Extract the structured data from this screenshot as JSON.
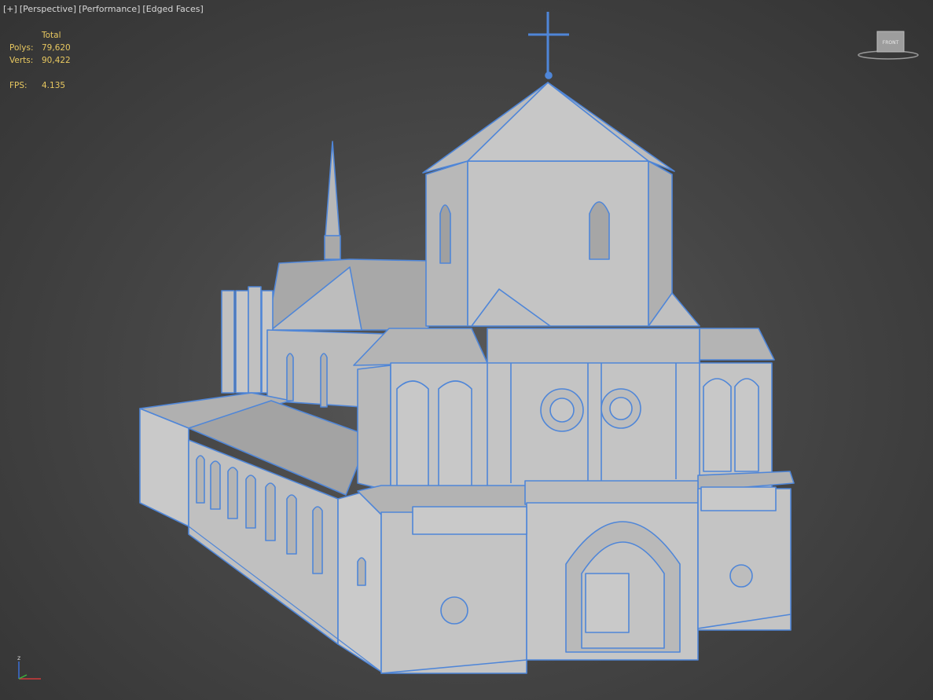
{
  "viewport": {
    "labels": [
      "[+]",
      "[Perspective]",
      "[Performance]",
      "[Edged Faces]"
    ]
  },
  "stats": {
    "header": "Total",
    "polys_label": "Polys:",
    "polys_value": "79,620",
    "verts_label": "Verts:",
    "verts_value": "90,422",
    "fps_label": "FPS:",
    "fps_value": "4.135"
  },
  "viewcube": {
    "face_label": "FRONT"
  },
  "axis": {
    "z_label": "z"
  },
  "colors": {
    "background": "#464646",
    "model_fill": "#b4b4b4",
    "edge": "#4f86d8",
    "stats_text": "#e8c860"
  }
}
